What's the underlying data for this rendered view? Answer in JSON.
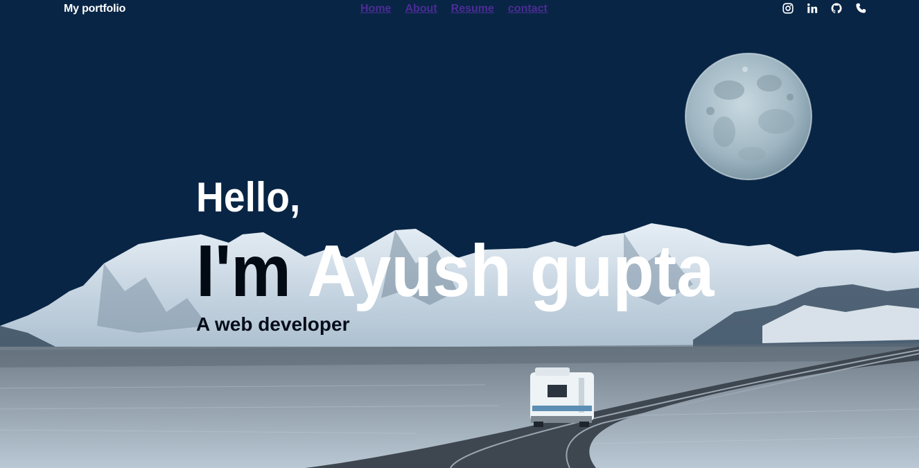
{
  "header": {
    "brand": "My portfolio",
    "nav": [
      {
        "label": "Home"
      },
      {
        "label": "About"
      },
      {
        "label": "Resume"
      },
      {
        "label": "contact"
      }
    ],
    "social": [
      "instagram-icon",
      "linkedin-icon",
      "github-icon",
      "phone-icon"
    ]
  },
  "hero": {
    "greeting": "Hello,",
    "name_prefix": "I'm",
    "name": "Ayush gupta",
    "tagline": "A web developer"
  },
  "colors": {
    "sky": "#082545",
    "nav_link": "#4c2c96",
    "text_light": "#ffffff",
    "text_dark": "#050c18"
  }
}
